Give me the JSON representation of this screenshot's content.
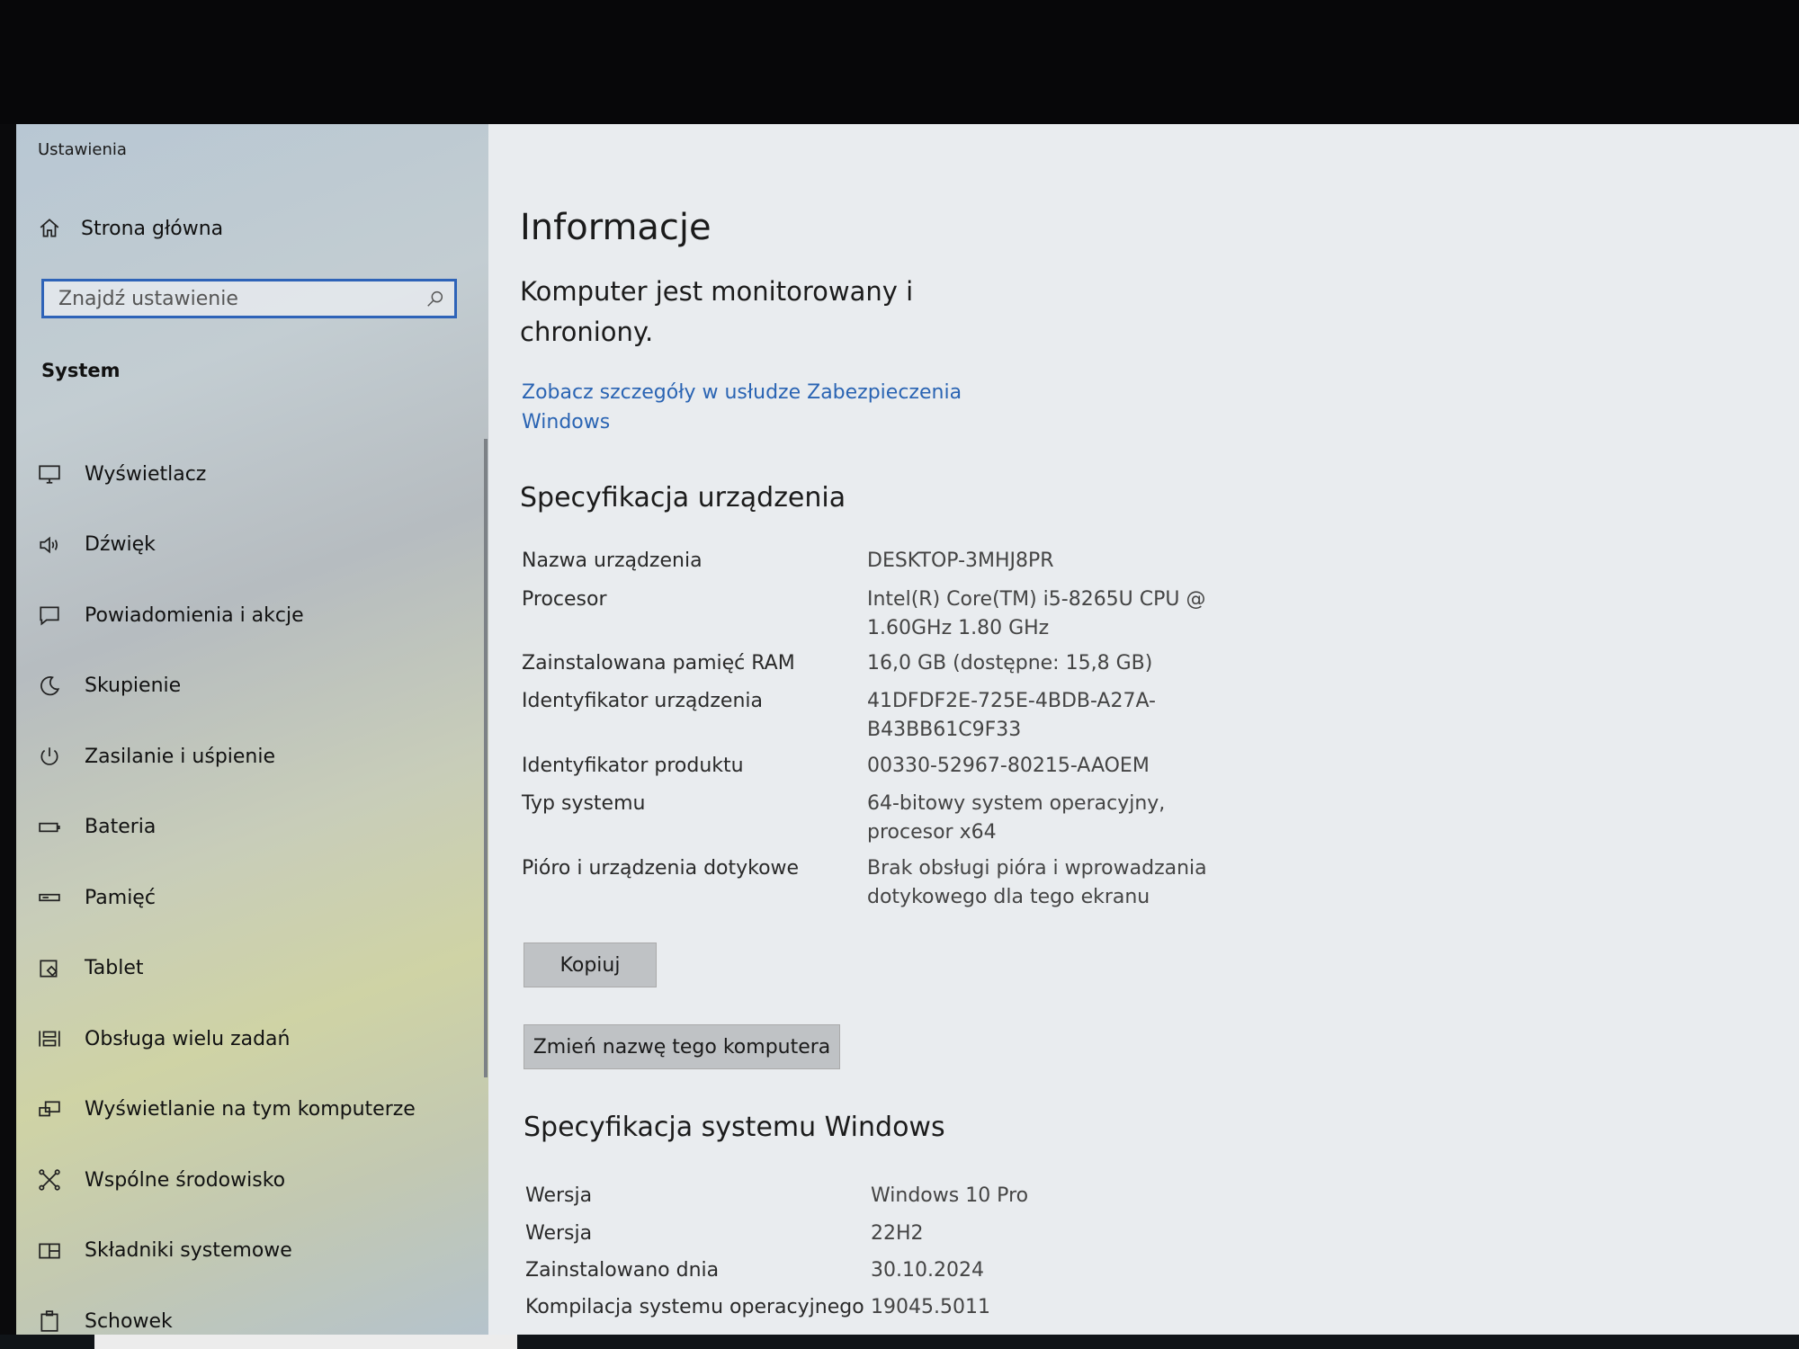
{
  "window": {
    "title": "Ustawienia"
  },
  "sidebar": {
    "home_label": "Strona główna",
    "search": {
      "placeholder": "Znajdź ustawienie"
    },
    "section": "System",
    "items": [
      {
        "label": "Wyświetlacz",
        "icon": "monitor-icon"
      },
      {
        "label": "Dźwięk",
        "icon": "speaker-icon"
      },
      {
        "label": "Powiadomienia i akcje",
        "icon": "notification-icon"
      },
      {
        "label": "Skupienie",
        "icon": "moon-icon"
      },
      {
        "label": "Zasilanie i uśpienie",
        "icon": "power-icon"
      },
      {
        "label": "Bateria",
        "icon": "battery-icon"
      },
      {
        "label": "Pamięć",
        "icon": "storage-icon"
      },
      {
        "label": "Tablet",
        "icon": "tablet-icon"
      },
      {
        "label": "Obsługa wielu zadań",
        "icon": "multitasking-icon"
      },
      {
        "label": "Wyświetlanie na tym komputerze",
        "icon": "projecting-icon"
      },
      {
        "label": "Wspólne środowisko",
        "icon": "shared-experiences-icon"
      },
      {
        "label": "Składniki systemowe",
        "icon": "system-components-icon"
      },
      {
        "label": "Schowek",
        "icon": "clipboard-icon"
      }
    ]
  },
  "main": {
    "title": "Informacje",
    "protection_text": "Komputer jest monitorowany i chroniony.",
    "protection_link": "Zobacz szczegóły w usłudze Zabezpieczenia Windows",
    "device_spec": {
      "heading": "Specyfikacja urządzenia",
      "rows": [
        {
          "key": "Nazwa urządzenia",
          "value": "DESKTOP-3MHJ8PR"
        },
        {
          "key": "Procesor",
          "value": "Intel(R) Core(TM) i5-8265U CPU @ 1.60GHz   1.80 GHz"
        },
        {
          "key": "Zainstalowana pamięć RAM",
          "value": "16,0 GB (dostępne: 15,8 GB)"
        },
        {
          "key": "Identyfikator urządzenia",
          "value": "41DFDF2E-725E-4BDB-A27A-B43BB61C9F33"
        },
        {
          "key": "Identyfikator produktu",
          "value": "00330-52967-80215-AAOEM"
        },
        {
          "key": "Typ systemu",
          "value": "64-bitowy system operacyjny, procesor x64"
        },
        {
          "key": "Pióro i urządzenia dotykowe",
          "value": "Brak obsługi pióra i wprowadzania dotykowego dla tego ekranu"
        }
      ],
      "copy_button": "Kopiuj",
      "rename_button": "Zmień nazwę tego komputera"
    },
    "windows_spec": {
      "heading": "Specyfikacja systemu Windows",
      "rows": [
        {
          "key": "Wersja",
          "value": "Windows 10 Pro"
        },
        {
          "key": "Wersja",
          "value": "22H2"
        },
        {
          "key": "Zainstalowano dnia",
          "value": "30.10.2024"
        },
        {
          "key": "Kompilacja systemu operacyjnego",
          "value": "19045.5011"
        }
      ]
    }
  },
  "colors": {
    "accent": "#2e63b8",
    "link": "#2a64b3"
  }
}
